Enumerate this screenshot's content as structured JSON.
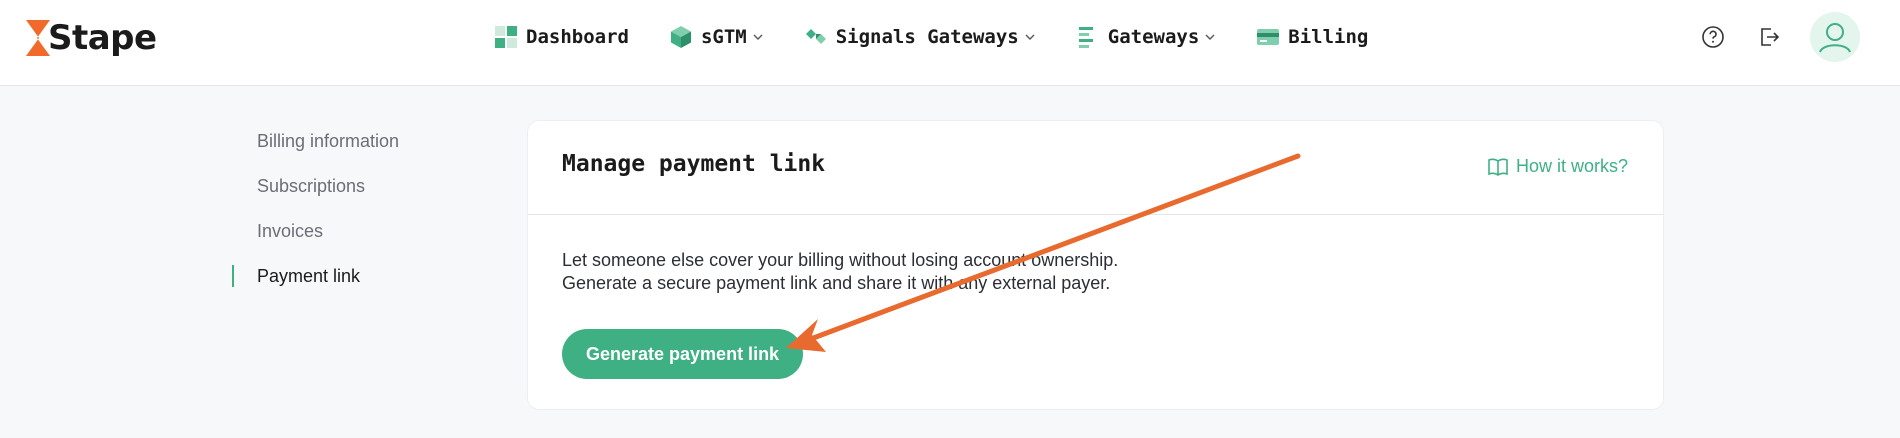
{
  "brand": {
    "name": "Stape",
    "accent": "#3fb084",
    "logo_color": "#f16a2b",
    "annotation_color": "#e86a2e"
  },
  "nav": {
    "items": [
      {
        "label": "Dashboard",
        "icon": "dashboard-grid-icon",
        "has_dropdown": false
      },
      {
        "label": "sGTM",
        "icon": "cube-icon",
        "has_dropdown": true
      },
      {
        "label": "Signals Gateways",
        "icon": "signals-icon",
        "has_dropdown": true
      },
      {
        "label": "Gateways",
        "icon": "lines-icon",
        "has_dropdown": true
      },
      {
        "label": "Billing",
        "icon": "credit-card-icon",
        "has_dropdown": false
      }
    ]
  },
  "header_actions": {
    "help_icon": "question-circle-icon",
    "logout_icon": "logout-icon",
    "avatar_icon": "user-icon"
  },
  "sidebar": {
    "items": [
      {
        "label": "Billing information",
        "active": false
      },
      {
        "label": "Subscriptions",
        "active": false
      },
      {
        "label": "Invoices",
        "active": false
      },
      {
        "label": "Payment link",
        "active": true
      }
    ]
  },
  "card": {
    "title": "Manage payment link",
    "how_link": "How it works?",
    "description_line1": "Let someone else cover your billing without losing account ownership.",
    "description_line2": "Generate a secure payment link and share it with any external payer.",
    "button_label": "Generate payment link"
  }
}
